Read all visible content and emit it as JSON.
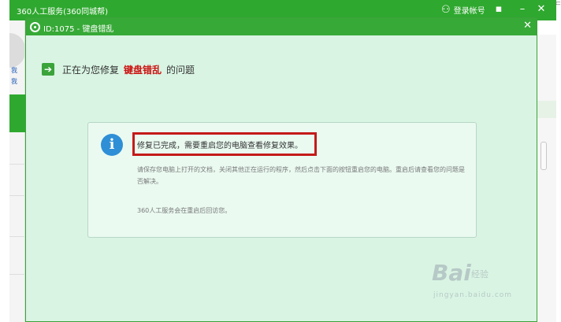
{
  "outer_window": {
    "title": "360人工服务(360同城帮)",
    "login_label": "登录帐号",
    "controls": {
      "menu": "▪",
      "minimize": "–",
      "close": "✕"
    },
    "left_links": [
      "我",
      "我"
    ]
  },
  "dialog": {
    "title": "ID:1075 - 键盘错乱",
    "close": "✕",
    "heading": {
      "prefix": "正在为您修复",
      "highlight": "键盘错乱",
      "suffix": "的问题"
    },
    "card": {
      "info_glyph": "i",
      "main_text": "修复已完成，需要重启您的电脑查看修复效果。",
      "body_text": "请保存您电脑上打开的文档，关闭其他正在运行的程序，然后点击下面的按钮重启您的电脑。重启后请查看您的问题是否解决。",
      "footer_text": "360人工服务会在重启后回访您。"
    }
  },
  "watermark": {
    "brand": "Bai",
    "sub": "经验",
    "url": "jingyan.baidu.com"
  },
  "colors": {
    "title_green": "#37a937",
    "dialog_bg": "#d9f4e3",
    "highlight_red": "#cc1111",
    "info_blue": "#2f8fd6"
  }
}
